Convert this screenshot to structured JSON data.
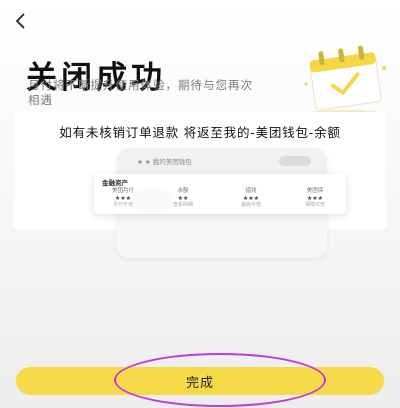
{
  "header": {
    "back_icon": "chevron-left-icon",
    "title": "关闭成功",
    "subtitle": "月付将不断提升使用体验，期待与您再次相遇"
  },
  "illustration": {
    "icon": "calendar-check-icon"
  },
  "notice": {
    "text": "如有未核销订单退款 将返至我的-美团钱包-余额"
  },
  "preview": {
    "phone_title": "★ ★ 我的美团钱包",
    "assets_title": "金融资产",
    "columns": [
      {
        "label": "美团月付",
        "value": "★★★",
        "sub": "月付可用"
      },
      {
        "label": "余额",
        "value": "★★",
        "sub": "查看明细"
      },
      {
        "label": "借钱",
        "value": "★★★",
        "sub": "最高可借"
      },
      {
        "label": "美团保",
        "value": "★★★",
        "sub": "保障可查"
      }
    ]
  },
  "footer": {
    "done_label": "完成"
  },
  "colors": {
    "accent_yellow": "#f6da4a",
    "annotation_purple": "#c03bd6"
  }
}
